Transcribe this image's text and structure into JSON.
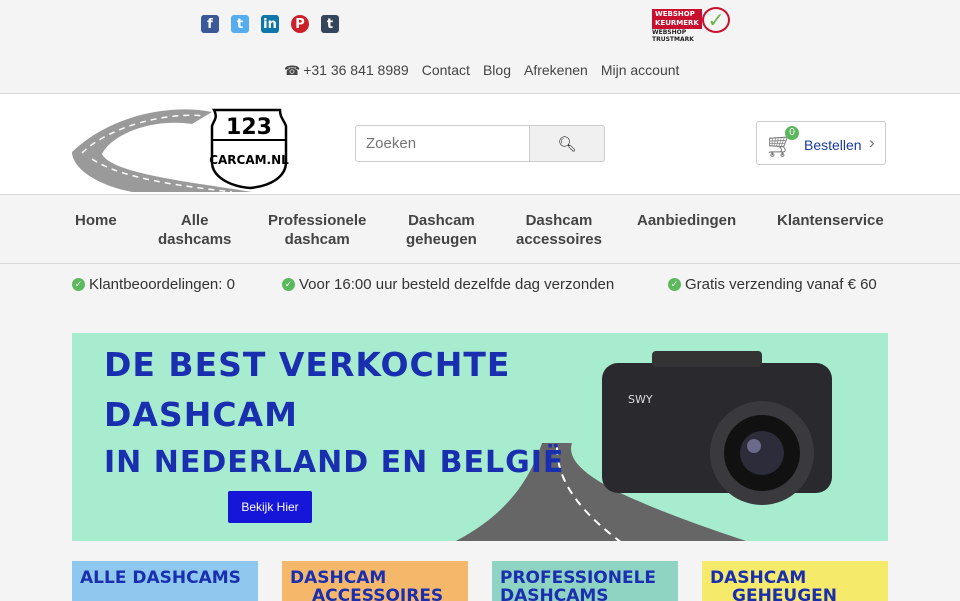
{
  "social": {
    "facebook": "f",
    "twitter": "t",
    "linkedin": "in",
    "pinterest": "P",
    "tumblr": "t"
  },
  "trustmark": {
    "line1": "WEBSHOP",
    "line2": "KEURMERK",
    "caption": "WEBSHOP TRUSTMARK"
  },
  "toplinks": {
    "phone": "+31 36 841 8989",
    "contact": "Contact",
    "blog": "Blog",
    "checkout": "Afrekenen",
    "account": "Mijn account"
  },
  "logo": {
    "number": "123",
    "text": "CARCAM.NL"
  },
  "search": {
    "placeholder": "Zoeken"
  },
  "cart": {
    "count": "0",
    "label": "Bestellen"
  },
  "nav": [
    {
      "line1": "Home",
      "line2": ""
    },
    {
      "line1": "Alle",
      "line2": "dashcams"
    },
    {
      "line1": "Professionele",
      "line2": "dashcam"
    },
    {
      "line1": "Dashcam",
      "line2": "geheugen"
    },
    {
      "line1": "Dashcam",
      "line2": "accessoires"
    },
    {
      "line1": "Aanbiedingen",
      "line2": ""
    },
    {
      "line1": "Klantenservice",
      "line2": ""
    }
  ],
  "usps": [
    "Klantbeoordelingen: 0",
    "Voor 16:00 uur besteld dezelfde dag verzonden",
    "Gratis verzending vanaf € 60"
  ],
  "banner": {
    "line1": "DE BEST VERKOCHTE",
    "line2": "DASHCAM",
    "line3": "IN NEDERLAND EN BELGIË",
    "cta": "Bekijk Hier",
    "camera_brand": "SWY"
  },
  "cards": [
    {
      "line1": "ALLE DASHCAMS",
      "line2": "",
      "color": "#8ec8ee"
    },
    {
      "line1": "DASHCAM",
      "line2": "ACCESSOIRES",
      "color": "#f5b86a"
    },
    {
      "line1": "PROFESSIONELE",
      "line2": "DASHCAMS",
      "color": "#8fd3c3"
    },
    {
      "line1": "DASHCAM",
      "line2": "GEHEUGEN",
      "color": "#f5ea6a"
    }
  ]
}
